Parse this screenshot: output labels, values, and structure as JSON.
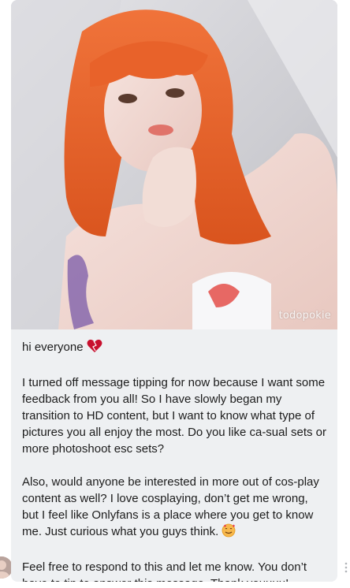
{
  "post": {
    "watermark": "todopokie",
    "greeting": "hi everyone",
    "paragraphs": [
      "I turned off message tipping for now because I want some feedback from you all! So I have slowly began my transition to HD content, but I want to know what type of pictures you all enjoy the most. Do you like ca-sual sets or more photoshoot esc sets?",
      "Also, would anyone be interested in more out of cos-play content as well? I love cosplaying, don’t get me wrong, but I feel like Onlyfans is a place where you get to know me. Just curious what you guys think.",
      "Feel free to respond to this and let me know. You don’t have to tip to answer this message. Thank youuuu!"
    ],
    "icons": {
      "greeting_emoji": "heart-icon",
      "paragraph_emoji": "smiling-face-with-hearts-icon",
      "options": "more-options-icon"
    }
  }
}
